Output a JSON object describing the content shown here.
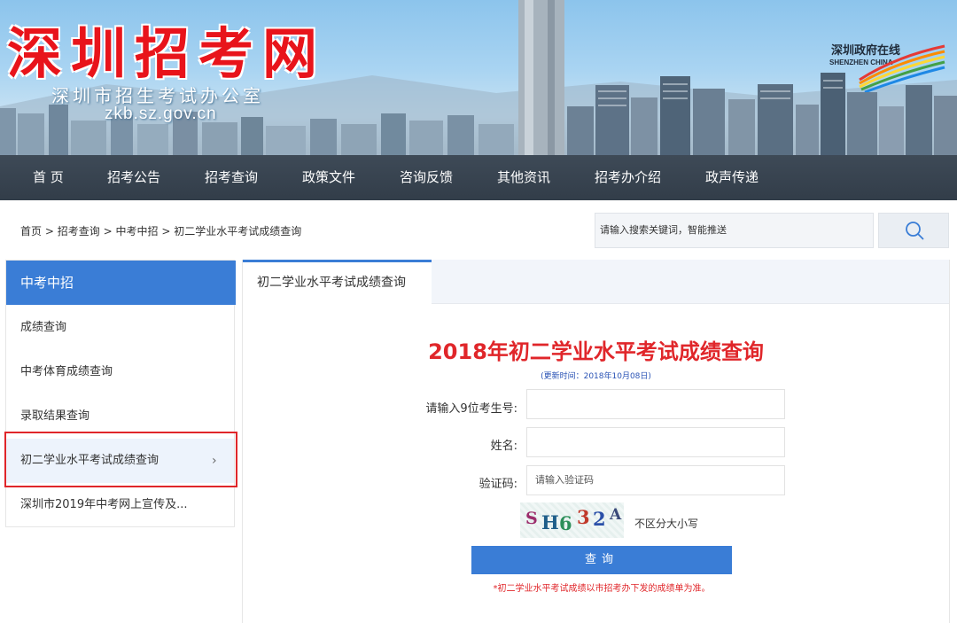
{
  "header": {
    "site_title": "深圳招考网",
    "site_subtitle": "深圳市招生考试办公室",
    "site_domain": "zkb.sz.gov.cn",
    "gov_logo_cn": "深圳政府在线",
    "gov_logo_en": "SHENZHEN CHINA"
  },
  "nav": {
    "items": [
      {
        "label": "首 页"
      },
      {
        "label": "招考公告"
      },
      {
        "label": "招考查询"
      },
      {
        "label": "政策文件"
      },
      {
        "label": "咨询反馈"
      },
      {
        "label": "其他资讯"
      },
      {
        "label": "招考办介绍"
      },
      {
        "label": "政声传递"
      }
    ]
  },
  "breadcrumb": {
    "items": [
      "首页",
      "招考查询",
      "中考中招",
      "初二学业水平考试成绩查询"
    ],
    "separator": ">"
  },
  "search": {
    "placeholder": "请输入搜索关键词，智能推送",
    "icon": "search-icon"
  },
  "sidebar": {
    "heading": "中考中招",
    "items": [
      {
        "label": "成绩查询"
      },
      {
        "label": "中考体育成绩查询"
      },
      {
        "label": "录取结果查询"
      },
      {
        "label": "初二学业水平考试成绩查询",
        "active": true
      },
      {
        "label": "深圳市2019年中考网上宣传及..."
      }
    ],
    "arrow": "›"
  },
  "main": {
    "tab_label": "初二学业水平考试成绩查询",
    "form_title": "2018年初二学业水平考试成绩查询",
    "updated_note": "(更新时间：2018年10月08日)",
    "fields": {
      "exam_no_label": "请输入9位考生号:",
      "exam_no_value": "",
      "name_label": "姓名:",
      "name_value": "",
      "captcha_label": "验证码:",
      "captcha_placeholder": "请输入验证码"
    },
    "captcha": {
      "chars": [
        "S",
        "H",
        "6",
        "3",
        "2",
        "A"
      ],
      "note": "不区分大小写"
    },
    "submit_label": "查询",
    "footnote": "*初二学业水平考试成绩以市招考办下发的成绩单为准。"
  },
  "colors": {
    "accent_blue": "#3a7dd6",
    "title_red": "#e0262a",
    "nav_bg": "#323d49"
  }
}
